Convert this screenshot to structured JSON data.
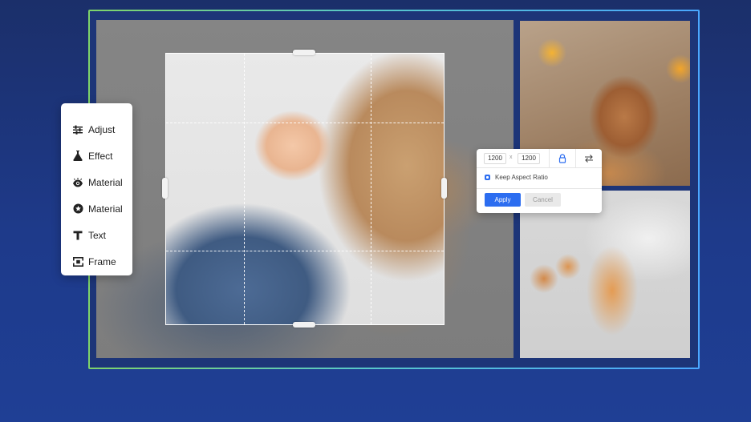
{
  "toolbox": {
    "items": [
      {
        "label": "Adjust",
        "icon": "sliders-icon"
      },
      {
        "label": "Effect",
        "icon": "flask-icon"
      },
      {
        "label": "Material",
        "icon": "eye-icon"
      },
      {
        "label": "Material",
        "icon": "badge-icon"
      },
      {
        "label": "Text",
        "icon": "text-icon"
      },
      {
        "label": "Frame",
        "icon": "frame-icon"
      }
    ]
  },
  "resize_dialog": {
    "width_value": "1200",
    "separator": "x",
    "height_value": "1200",
    "keep_aspect_label": "Keep Aspect Ratio",
    "keep_aspect_checked": true,
    "apply_label": "Apply",
    "cancel_label": "Cancel"
  },
  "colors": {
    "background": "#1e3a8a",
    "accent": "#2c6df0",
    "frame_gradient": [
      "#7fd36a",
      "#4aa7ff"
    ]
  }
}
